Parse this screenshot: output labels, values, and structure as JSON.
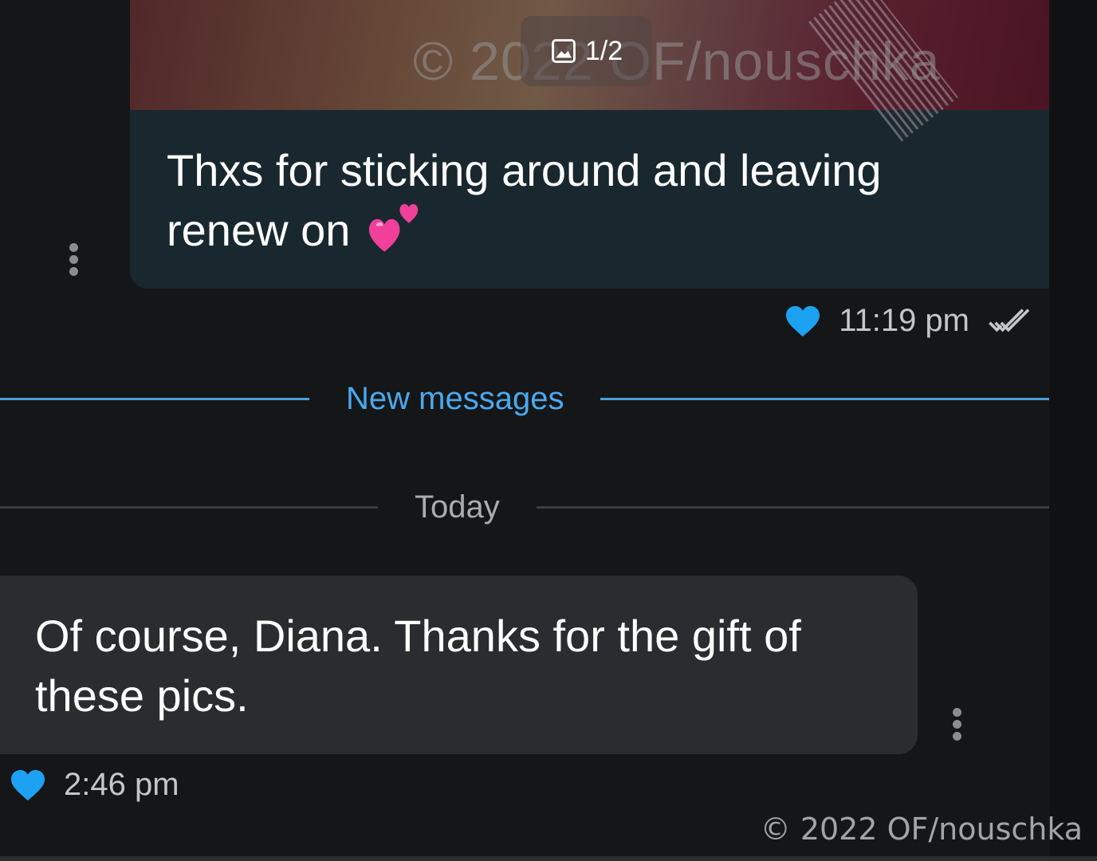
{
  "incoming_message": {
    "image_counter": "1/2",
    "image_watermark": "© 2022 OF/nouschka",
    "text": "Thxs for sticking around and leaving renew on",
    "emoji": "two-hearts",
    "time": "11:19 pm",
    "liked": true,
    "read_status": "double-check"
  },
  "new_messages_divider": {
    "label": "New messages"
  },
  "date_divider": {
    "label": "Today"
  },
  "outgoing_message": {
    "text": "Of course, Diana. Thanks for the gift of these pics.",
    "time": "2:46 pm",
    "liked": true
  },
  "footer": {
    "watermark": "© 2022 OF/nouschka"
  },
  "colors": {
    "background": "#151618",
    "incoming_bubble": "#19282f",
    "outgoing_bubble": "#2a2c2f",
    "accent_blue": "#4aa9ef",
    "heart_blue": "#1da1f2"
  }
}
